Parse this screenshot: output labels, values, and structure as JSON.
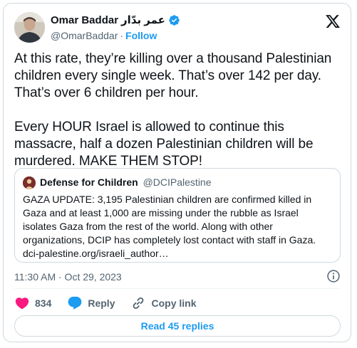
{
  "author": {
    "name": "Omar Baddar",
    "name_arabic": "عمر بدّار",
    "handle": "@OmarBaddar",
    "follow_label": "Follow",
    "verified": true
  },
  "tweet": {
    "text": "At this rate, they’re killing over a thousand Palestinian children every single week. That’s over 142 per day. That’s over 6 children per hour.\n\nEvery HOUR Israel is allowed to continue this massacre, half a dozen Palestinian children will be murdered. MAKE THEM STOP!",
    "timestamp": "11:30 AM · Oct 29, 2023"
  },
  "quote": {
    "name": "Defense for Children",
    "handle": "@DCIPalestine",
    "text": "GAZA UPDATE: 3,195 Palestinian children are confirmed killed in Gaza and at least 1,000 are missing under the rubble as Israel isolates Gaza from the rest of the world. Along with other organizations, DCIP has completely lost contact with staff in Gaza. dci-palestine.org/israeli_author…"
  },
  "actions": {
    "like_count": "834",
    "reply_label": "Reply",
    "copy_label": "Copy link"
  },
  "read_replies_label": "Read 45 replies",
  "colors": {
    "accent": "#1d9bf0",
    "like": "#f91880",
    "muted": "#536471",
    "border": "#cfd9de"
  },
  "icons": [
    "verified-badge-icon",
    "x-logo-icon",
    "info-icon",
    "heart-icon",
    "reply-bubble-icon",
    "copy-link-icon"
  ]
}
